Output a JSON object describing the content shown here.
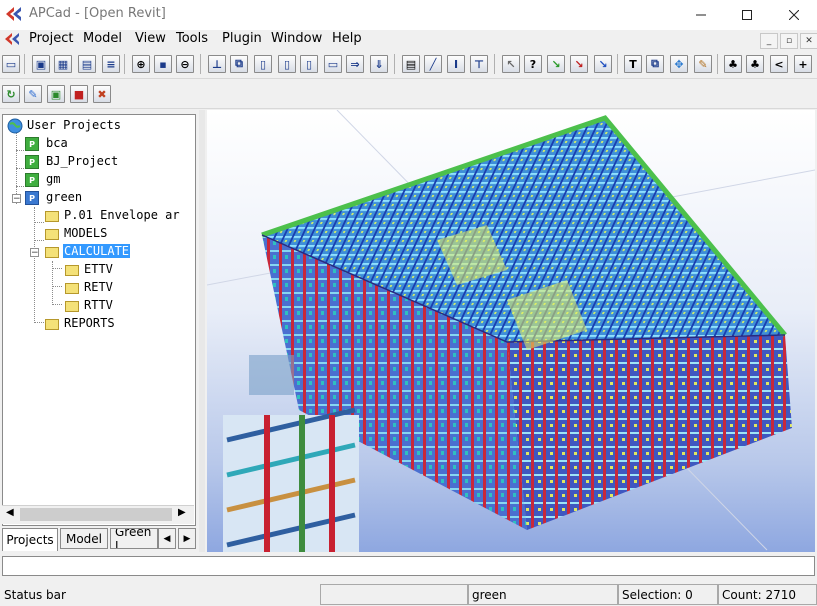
{
  "window": {
    "title": "APCad - [Open Revit]"
  },
  "menu": [
    "Project",
    "Model",
    "View",
    "Tools",
    "Plugin",
    "Window",
    "Help"
  ],
  "toolbar1": [
    "new-doc",
    "save-as",
    "window-a",
    "window-b",
    "align-doc",
    "zoom-in",
    "save",
    "zoom-out",
    "frame-a",
    "frame-b",
    "box-a",
    "box-b",
    "box-c",
    "box-d",
    "box-e",
    "box-f",
    "box-g",
    "properties",
    "draw-line",
    "beam",
    "column",
    "select",
    "query",
    "move-green",
    "move-red",
    "move-blue",
    "text",
    "copy",
    "snap",
    "edit",
    "tree-a",
    "tree-b",
    "share",
    "tree-add"
  ],
  "toolbar2": [
    "refresh",
    "edit",
    "image",
    "lock",
    "delete"
  ],
  "tree": {
    "root": "User Projects",
    "projects": [
      "bca",
      "BJ_Project",
      "gm",
      "green"
    ],
    "folders": [
      "P.01 Envelope ar",
      "MODELS",
      "CALCULATE",
      "REPORTS"
    ],
    "calc_children": [
      "ETTV",
      "RETV",
      "RTTV"
    ]
  },
  "tabs": [
    "Projects",
    "Model",
    "Green I"
  ],
  "status": {
    "left": "Status bar",
    "project": "green",
    "selection": "Selection: 0",
    "count": "Count: 2710"
  }
}
